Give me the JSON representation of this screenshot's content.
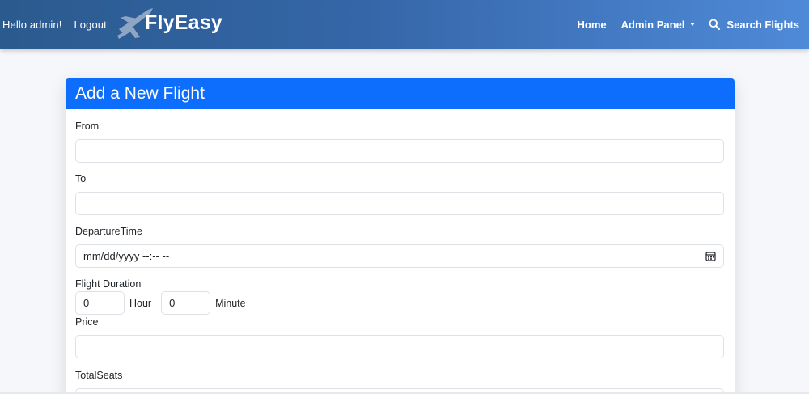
{
  "nav": {
    "greeting": "Hello admin!",
    "logout": "Logout",
    "brand": "FlyEasy",
    "home": "Home",
    "admin_panel": "Admin Panel",
    "search_flights": "Search Flights"
  },
  "form": {
    "title": "Add a New Flight",
    "from_label": "From",
    "from_value": "",
    "to_label": "To",
    "to_value": "",
    "departure_label": "DepartureTime",
    "departure_placeholder": "mm/dd/yyyy --:-- --",
    "duration_label": "Flight Duration",
    "hours_value": "0",
    "hour_unit": "Hour",
    "minutes_value": "0",
    "minute_unit": "Minute",
    "price_label": "Price",
    "price_value": "",
    "seats_label": "TotalSeats",
    "seats_value": ""
  },
  "colors": {
    "nav_gradient_start": "#2b5a8e",
    "nav_gradient_end": "#4f8ad8",
    "card_header": "#0d6efd"
  },
  "icons": {
    "brand_logo": "airplane-icon",
    "search": "search-icon",
    "calendar": "calendar-icon",
    "dropdown": "chevron-down-icon"
  }
}
